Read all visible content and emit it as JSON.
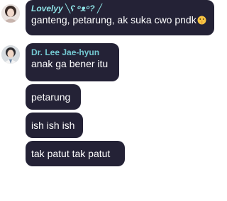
{
  "messages": [
    {
      "sender": "Lovelyy ╲ʕ ᵒᴥᵒ? ╱",
      "text": "ganteng, petarung, ak suka cwo pndk",
      "emoji": "shushing-face-emoji"
    },
    {
      "sender": "Dr. Lee Jae-hyun",
      "text": "anak ga bener itu"
    },
    {
      "text": "petarung"
    },
    {
      "text": "ish ish ish"
    },
    {
      "text": "tak patut tak patut"
    }
  ],
  "colors": {
    "bubble_bg": "#242236",
    "bubble_text": "#ffffff",
    "sender_lovelyy": "#8fe3e6",
    "sender_lee": "#73c8d1",
    "page_bg": "#ffffff"
  }
}
